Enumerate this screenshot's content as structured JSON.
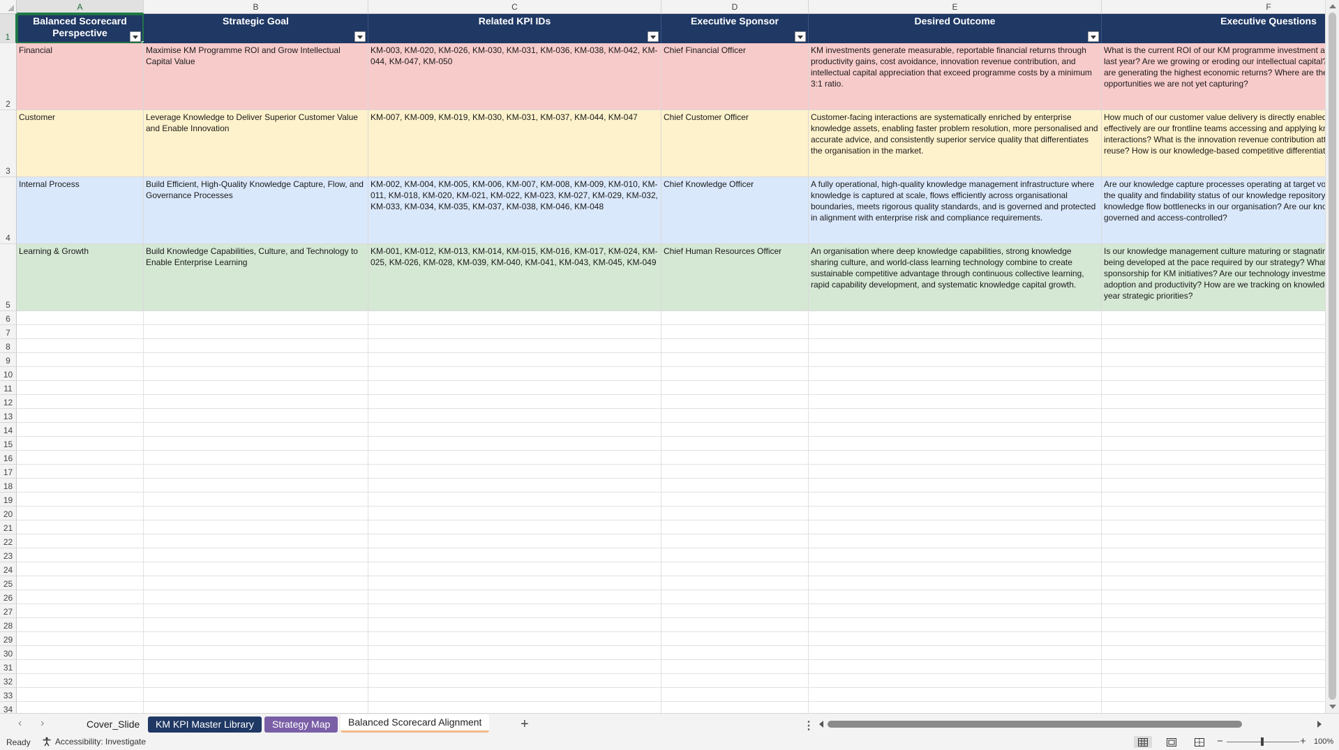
{
  "columns": [
    "A",
    "B",
    "C",
    "D",
    "E",
    "F"
  ],
  "row_numbers": [
    "1",
    "2",
    "3",
    "4",
    "5",
    "6",
    "7",
    "8",
    "9",
    "10",
    "11",
    "12",
    "13",
    "14",
    "15",
    "16",
    "17",
    "18",
    "19",
    "20",
    "21",
    "22",
    "23",
    "24",
    "25",
    "26",
    "27",
    "28",
    "29",
    "30",
    "31",
    "32",
    "33",
    "34"
  ],
  "headers": [
    "Balanced Scorecard Perspective",
    "Strategic Goal",
    "Related KPI IDs",
    "Executive Sponsor",
    "Desired Outcome",
    "Executive Questions"
  ],
  "rows": [
    {
      "fill": "#f8cbcb",
      "cells": [
        "Financial",
        "Maximise KM Programme ROI and Grow Intellectual Capital Value",
        "KM-003, KM-020, KM-026, KM-030, KM-031, KM-036, KM-038, KM-042, KM-044, KM-047, KM-050",
        "Chief Financial Officer",
        "KM investments generate measurable, reportable financial returns through productivity gains, cost avoidance, innovation revenue contribution, and intellectual capital appreciation that exceed programme costs by a minimum 3:1 ratio.",
        "What is the current ROI of our KM programme investment and how has it changed since last year? Are we growing or eroding our intellectual capital? Which knowledge assets are generating the highest economic returns? Where are the cost avoidance opportunities we are not yet capturing?"
      ]
    },
    {
      "fill": "#fef2cc",
      "cells": [
        "Customer",
        "Leverage Knowledge to Deliver Superior Customer Value and Enable Innovation",
        "KM-007, KM-009, KM-019, KM-030, KM-031, KM-037, KM-044, KM-047",
        "Chief Customer Officer",
        "Customer-facing interactions are systematically enriched by enterprise knowledge assets, enabling faster problem resolution, more personalised and accurate advice, and consistently superior service quality that differentiates the organisation in the market.",
        "How much of our customer value delivery is directly enabled by knowledge? How effectively are our frontline teams accessing and applying knowledge in customer interactions? What is the innovation revenue contribution attributable to knowledge reuse? How is our knowledge-based competitive differentiation trending?"
      ]
    },
    {
      "fill": "#dae8fb",
      "cells": [
        "Internal Process",
        "Build Efficient, High-Quality Knowledge Capture, Flow, and Governance Processes",
        "KM-002, KM-004, KM-005, KM-006, KM-007, KM-008, KM-009, KM-010, KM-011, KM-018, KM-020, KM-021, KM-022, KM-023, KM-027, KM-029, KM-032, KM-033, KM-034, KM-035, KM-037, KM-038, KM-046, KM-048",
        "Chief Knowledge Officer",
        "A fully operational, high-quality knowledge management infrastructure where knowledge is captured at scale, flows efficiently across organisational boundaries, meets rigorous quality standards, and is governed and protected in alignment with enterprise risk and compliance requirements.",
        "Are our knowledge capture processes operating at target volume and quality? What is the quality and findability status of our knowledge repository? Where are the critical knowledge flow bottlenecks in our organisation? Are our knowledge assets appropriately governed and access-controlled?"
      ]
    },
    {
      "fill": "#d5e8d4",
      "cells": [
        "Learning & Growth",
        "Build Knowledge Capabilities, Culture, and Technology to Enable Enterprise Learning",
        "KM-001, KM-012, KM-013, KM-014, KM-015, KM-016, KM-017, KM-024, KM-025, KM-026, KM-028, KM-039, KM-040, KM-041, KM-043, KM-045, KM-049",
        "Chief Human Resources Officer",
        "An organisation where deep knowledge capabilities, strong knowledge sharing culture, and world-class learning technology combine to create sustainable competitive advantage through continuous collective learning, rapid capability development, and systematic knowledge capital growth.",
        "Is our knowledge management culture maturing or stagnating? Are critical competencies being developed at the pace required by our strategy? What is the status of executive sponsorship for KM initiatives? Are our technology investments driving measurable adoption and productivity? How are we tracking on knowledge readiness for our 3–5 year strategic priorities?"
      ]
    }
  ],
  "sheet_tabs": {
    "tab1": "Cover_Slide",
    "tab2": "KM KPI Master Library",
    "tab3": "Strategy Map",
    "tab4": "Balanced Scorecard Alignment",
    "active": "Balanced Scorecard Alignment"
  },
  "icons": {
    "prev_sheet": "chevron-left-icon",
    "next_sheet": "chevron-right-icon",
    "add_sheet": "plus-icon",
    "more": "more-vertical-icon",
    "accessibility": "accessibility-icon",
    "normal_view": "normal-view-icon",
    "page_layout": "page-layout-icon",
    "page_break": "page-break-preview-icon"
  },
  "status": {
    "ready": "Ready",
    "accessibility": "Accessibility: Investigate",
    "zoom": "100%"
  },
  "colors": {
    "header_fill": "#1f3864",
    "selection": "#217346",
    "tab_navy": "#1f3864",
    "tab_purple": "#7a5fa6",
    "active_tab_underline": "#f2b98a"
  }
}
